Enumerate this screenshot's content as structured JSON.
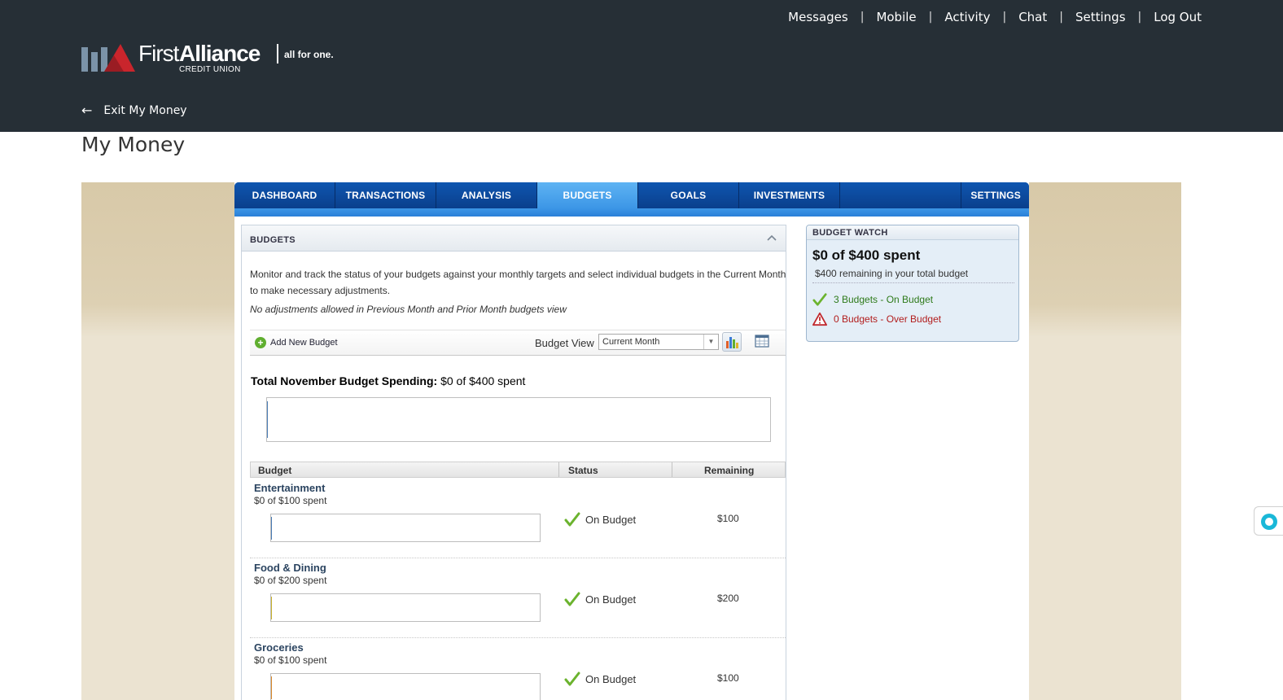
{
  "header": {
    "top_links": [
      {
        "label": "Messages"
      },
      {
        "label": "Mobile"
      },
      {
        "label": "Activity"
      },
      {
        "label": "Chat"
      },
      {
        "label": "Settings"
      },
      {
        "label": "Log Out"
      }
    ],
    "separator": "|",
    "logo": {
      "first": "First",
      "alliance": "Alliance",
      "credit_union": "CREDIT UNION",
      "tagline": "all for one."
    },
    "exit_label": "Exit My Money"
  },
  "page_title": "My Money",
  "tabs": [
    {
      "label": "DASHBOARD"
    },
    {
      "label": "TRANSACTIONS"
    },
    {
      "label": "ANALYSIS"
    },
    {
      "label": "BUDGETS",
      "active": true
    },
    {
      "label": "GOALS"
    },
    {
      "label": "INVESTMENTS"
    }
  ],
  "settings_tab": "SETTINGS",
  "budgets_panel": {
    "title": "BUDGETS",
    "description": "Monitor and track the status of your budgets against your monthly targets and select individual budgets in the Current Month to make necessary adjustments.",
    "note": "No adjustments allowed in Previous Month and Prior Month budgets view",
    "add_label": "Add New Budget",
    "view_label": "Budget View",
    "view_selected": "Current Month",
    "total_label": "Total November Budget Spending:",
    "total_value": "$0 of $400 spent",
    "total_progress": 0,
    "columns": {
      "budget": "Budget",
      "status": "Status",
      "remaining": "Remaining"
    },
    "rows": [
      {
        "name": "Entertainment",
        "spent": "$0 of $100 spent",
        "status": "On Budget",
        "remaining": "$100",
        "progress": 0,
        "color": "#4a7cb5"
      },
      {
        "name": "Food & Dining",
        "spent": "$0 of $200 spent",
        "status": "On Budget",
        "remaining": "$200",
        "progress": 0,
        "color": "#c8b22e"
      },
      {
        "name": "Groceries",
        "spent": "$0 of $100 spent",
        "status": "On Budget",
        "remaining": "$100",
        "progress": 0,
        "color": "#d9892b"
      }
    ]
  },
  "budget_watch": {
    "title": "BUDGET WATCH",
    "headline": "$0 of $400 spent",
    "sub": "$400 remaining in your total budget",
    "on_budget": "3 Budgets - On Budget",
    "over_budget": "0 Budgets - Over Budget"
  },
  "colors": {
    "header_bg": "#262f36",
    "tab_bg": "#0a3f8c",
    "tab_active": "#3c96e6",
    "on_budget": "#2e7a1a",
    "over_budget": "#b21d1d"
  },
  "icons": {
    "check": "check-icon",
    "warning": "warning-icon",
    "add": "plus-icon",
    "chart": "bar-chart-icon",
    "calendar": "calendar-icon",
    "collapse": "chevron-up-icon",
    "back": "arrow-left-icon"
  }
}
